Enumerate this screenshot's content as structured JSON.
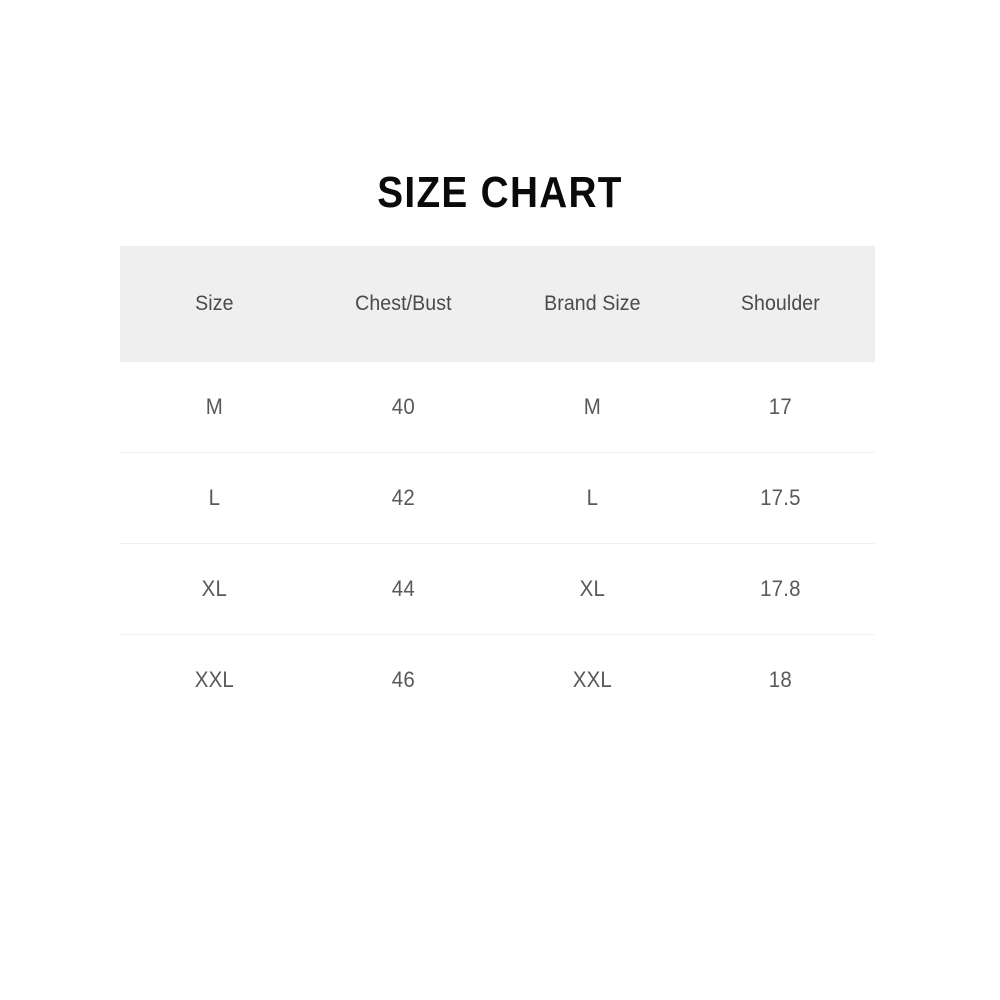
{
  "title": "SIZE CHART",
  "colors": {
    "page_background": "#ffffff",
    "title_text": "#0a0a0a",
    "header_background": "#efefef",
    "header_text": "#4a4a4a",
    "cell_text": "#595959",
    "row_divider": "#f1f1f1"
  },
  "chart_data": {
    "type": "table",
    "title": "SIZE CHART",
    "columns": [
      "Size",
      "Chest/Bust",
      "Brand Size",
      "Shoulder"
    ],
    "rows": [
      [
        "M",
        "40",
        "M",
        "17"
      ],
      [
        "L",
        "42",
        "L",
        "17.5"
      ],
      [
        "XL",
        "44",
        "XL",
        "17.8"
      ],
      [
        "XXL",
        "46",
        "XXL",
        "18"
      ]
    ]
  },
  "table": {
    "headers": [
      {
        "label": "Size"
      },
      {
        "label": "Chest/Bust"
      },
      {
        "label": "Brand Size"
      },
      {
        "label": "Shoulder"
      }
    ],
    "rows": [
      {
        "size": "M",
        "chest_bust": "40",
        "brand_size": "M",
        "shoulder": "17"
      },
      {
        "size": "L",
        "chest_bust": "42",
        "brand_size": "L",
        "shoulder": "17.5"
      },
      {
        "size": "XL",
        "chest_bust": "44",
        "brand_size": "XL",
        "shoulder": "17.8"
      },
      {
        "size": "XXL",
        "chest_bust": "46",
        "brand_size": "XXL",
        "shoulder": "18"
      }
    ]
  }
}
